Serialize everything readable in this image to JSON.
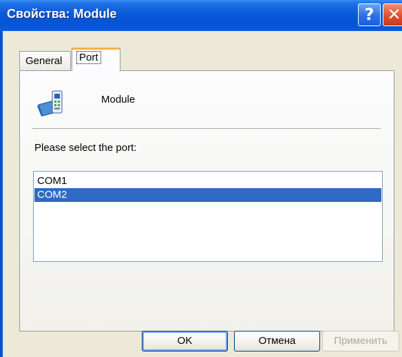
{
  "window": {
    "title": "Свойства: Module",
    "help_glyph": "?",
    "close_glyph": "✕"
  },
  "tabs": [
    {
      "label": "General",
      "active": false
    },
    {
      "label": "Port",
      "active": true
    }
  ],
  "device": {
    "icon": "modem-device-icon",
    "name": "Module"
  },
  "port_section": {
    "prompt": "Please select the port:",
    "ports": [
      {
        "label": "COM1",
        "selected": false
      },
      {
        "label": "COM2",
        "selected": true
      }
    ]
  },
  "buttons": {
    "ok": "OK",
    "cancel": "Отмена",
    "apply": "Применить"
  },
  "colors": {
    "titlebar": "#0454d3",
    "selection": "#316ac5",
    "active_tab_accent": "#f4b14a",
    "window_face": "#ece9d8"
  }
}
